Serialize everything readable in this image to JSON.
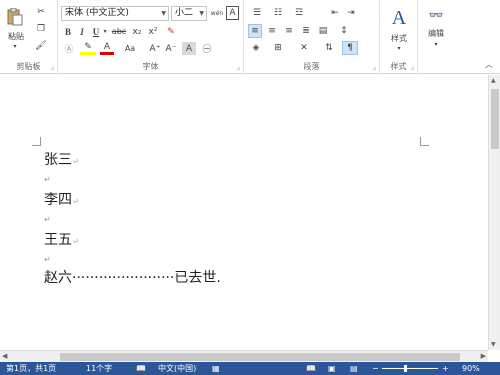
{
  "ribbon": {
    "clipboard": {
      "paste_label": "粘贴",
      "group_label": "剪贴板"
    },
    "font": {
      "font_name": "宋体 (中文正文)",
      "font_size": "小二",
      "group_label": "字体",
      "icons": {
        "bold": "B",
        "italic": "I",
        "underline": "U",
        "strike": "abc",
        "subscript": "x₂",
        "superscript": "x²",
        "aa": "Aa",
        "grow": "A⁺",
        "shrink": "A⁻",
        "phonetic": "wén",
        "border": "A",
        "circle": "㊀"
      }
    },
    "paragraph": {
      "group_label": "段落"
    },
    "styles": {
      "label": "样式",
      "group_label": "样式"
    },
    "editing": {
      "label": "编辑"
    }
  },
  "document": {
    "lines": [
      "张三",
      "李四",
      "王五",
      "赵六·······················已去世."
    ],
    "paragraph_mark": "↵"
  },
  "statusbar": {
    "page": "第1页，共1页",
    "words": "11个字",
    "language": "中文(中国)",
    "zoom": "90%"
  },
  "colors": {
    "accent": "#2b579a",
    "selected": "#cde3f7"
  }
}
